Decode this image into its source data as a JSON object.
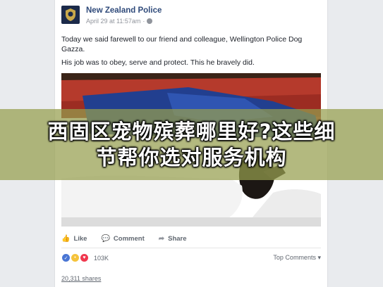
{
  "post": {
    "page_name": "New Zealand Police",
    "timestamp": "April 29 at 11:57am",
    "text_line1": "Today we said farewell to our friend and colleague, Wellington Police Dog Gazza.",
    "text_line2": "His job was to obey, serve and protect. This he bravely did."
  },
  "actions": {
    "like": "Like",
    "comment": "Comment",
    "share": "Share"
  },
  "stats": {
    "reaction_count": "103K",
    "top_comments": "Top Comments",
    "shares": "20,311 shares"
  },
  "overlay": {
    "line1": "西固区宠物殡葬哪里好?这些细",
    "line2": "节帮你选对服务机构"
  },
  "colors": {
    "page_name": "#2f4a7a",
    "banner": "#969e4e",
    "like_reaction": "#4a76d4",
    "sad_reaction": "#f5c33b",
    "love_reaction": "#f0384e"
  },
  "icons": {
    "avatar": "police-badge-icon",
    "like": "thumbs-up-icon",
    "comment": "speech-bubble-icon",
    "share": "share-arrow-icon"
  }
}
